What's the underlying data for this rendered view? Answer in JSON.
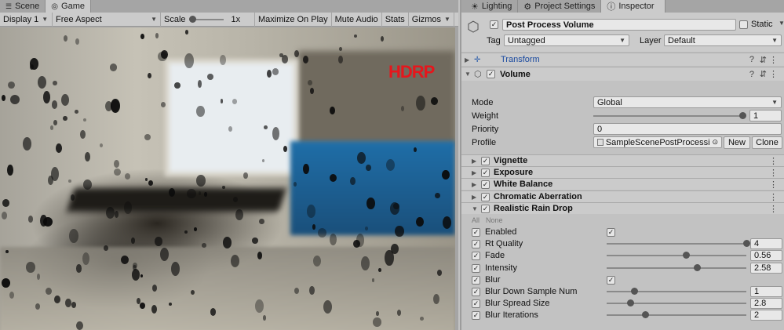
{
  "left_tabs": [
    "Scene",
    "Game"
  ],
  "game_toolbar": {
    "display": "Display 1",
    "aspect": "Free Aspect",
    "scale_label": "Scale",
    "scale_value": "1x",
    "maximize": "Maximize On Play",
    "mute": "Mute Audio",
    "stats": "Stats",
    "gizmos": "Gizmos"
  },
  "game_view": {
    "overlay_text": "HDRP"
  },
  "right_tabs": [
    "Lighting",
    "Project Settings",
    "Inspector"
  ],
  "header": {
    "name": "Post Process Volume",
    "static_label": "Static",
    "tag_label": "Tag",
    "tag_value": "Untagged",
    "layer_label": "Layer",
    "layer_value": "Default"
  },
  "components": {
    "transform": "Transform",
    "volume": "Volume"
  },
  "volume": {
    "mode_label": "Mode",
    "mode_value": "Global",
    "weight_label": "Weight",
    "weight_value": "1",
    "weight_level": 1.0,
    "priority_label": "Priority",
    "priority_value": "0",
    "profile_label": "Profile",
    "profile_value": "SampleScenePostProcessir",
    "new_button": "New",
    "clone_button": "Clone"
  },
  "overrides": [
    "Vignette",
    "Exposure",
    "White Balance",
    "Chromatic Aberration",
    "Realistic Rain Drop"
  ],
  "rain_all": "All",
  "rain_none": "None",
  "rain_params": [
    {
      "label": "Enabled",
      "type": "toggle"
    },
    {
      "label": "Rt Quality",
      "value": "4",
      "level": 1.0
    },
    {
      "label": "Fade",
      "value": "0.56",
      "level": 0.56
    },
    {
      "label": "Intensity",
      "value": "2.58",
      "level": 0.64
    },
    {
      "label": "Blur",
      "type": "toggle"
    },
    {
      "label": "Blur Down Sample Num",
      "value": "1",
      "level": 0.18
    },
    {
      "label": "Blur Spread Size",
      "value": "2.8",
      "level": 0.15
    },
    {
      "label": "Blur Iterations",
      "value": "2",
      "level": 0.26
    }
  ]
}
